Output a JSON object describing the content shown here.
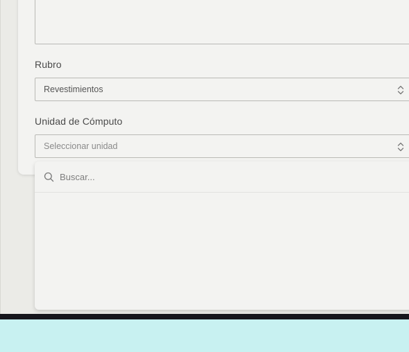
{
  "form": {
    "rubro": {
      "label": "Rubro",
      "value": "Revestimientos"
    },
    "unidad": {
      "label": "Unidad de Cómputo",
      "placeholder": "Seleccionar unidad"
    }
  },
  "dropdown": {
    "search_placeholder": "Buscar..."
  },
  "icons": {
    "search": "search-icon",
    "chevron": "chevron-up-down-icon"
  }
}
